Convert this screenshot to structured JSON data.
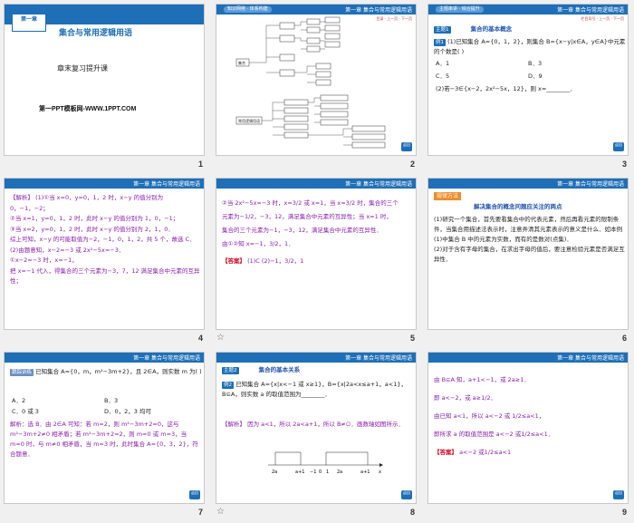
{
  "slides": [
    {
      "num": "1",
      "chapter_tag": "第一章",
      "chapter_sub": "集合与常用逻辑用语",
      "title": "集合与常用逻辑用语",
      "subtitle": "章末复习提升课",
      "site": "第一PPT模板网-WWW.1PPT.COM"
    },
    {
      "num": "2",
      "pill": "知识网络 · 体系构建",
      "header": "第一章  集合与常用逻辑用语",
      "sub_links": "目录 · 上一页 · 下一页",
      "diagram_root": "集合",
      "diagram_labels": [
        "概念",
        "关系",
        "运算",
        "元素特征",
        "表示方法",
        "子集",
        "真子集",
        "相等",
        "交集",
        "并集",
        "补集",
        "充分条件",
        "必要条件",
        "充要条件",
        "全称量词",
        "存在量词",
        "常用逻辑用语"
      ],
      "back": "返回"
    },
    {
      "num": "3",
      "pill": "主题串讲 · 综合提升",
      "header": "第一章  集合与常用逻辑用语",
      "sub_links": "栏目导引 · 上一页 · 下一页",
      "topic_tag": "主题1",
      "topic_title": "集合的基本概念",
      "ex_tag": "例1",
      "q1": "(1)已知集合 A={0，1，2}，则集合 B={x−y|x∈A，y∈A}中元素的个数是(    )",
      "choices": [
        "A．1",
        "B．3",
        "C．5",
        "D．9"
      ],
      "q2": "(2)若−3∈{x−2，2x²−5x，12}，则 x=________．",
      "back": "返回"
    },
    {
      "num": "4",
      "header": "第一章  集合与常用逻辑用语",
      "lines": [
        "【解析】 (1)①当 x=0，y=0，1，2 时，x−y 的值分别为 0，−1，−2；",
        "②当 x=1，y=0，1，2 时，此时 x−y 的值分别为 1，0，−1；",
        "③当 x=2，y=0，1，2 时，此时 x−y 的值分别为 2，1，0．",
        "综上可知，x−y 的可能取值为−2，−1，0，1，2，共 5 个，故选 C．",
        "(2)由题意知，x−2=−3 或 2x²−5x=−3．",
        "①x−2=−3 时，x=−1，",
        "把 x=−1 代入，得集合的三个元素为−3，7，12 满足集合中元素的互异性；"
      ]
    },
    {
      "num": "5",
      "header": "第一章  集合与常用逻辑用语",
      "lines": [
        "②当 2x²−5x=−3 时，x=3/2 或 x=1，当 x=3/2 时，集合的三个",
        "元素为−1/2，−3，12，满足集合中元素的互异性；当 x=1 时，",
        "集合的三个元素为−1，−3，12，满足集合中元素的互异性．",
        "由①②知 x=−1，3/2，1．"
      ],
      "answer_label": "【答案】",
      "answer": "(1)C  (2)−1，3/2，1"
    },
    {
      "num": "6",
      "header": "第一章  集合与常用逻辑用语",
      "tag": "规律方法",
      "title": "解决集合的概念问题应关注的两点",
      "lines": [
        "(1)研究一个集合，首先要看集合中的代表元素，然后再看元素的限制条件，当集合用描述法表示时，注意弄清其元素表示的意义是什么．如本例(1)中集合 B 中的元素为实数，而有的是数对(点集)．",
        "(2)对于含有字母的集合，在求出字母的值后，要注意检验元素是否满足互异性．"
      ]
    },
    {
      "num": "7",
      "header": "第一章  集合与常用逻辑用语",
      "tag": "跟踪训练",
      "q": "已知集合 A={0，m，m²−3m+2}，且 2∈A，则实数 m 为(    )",
      "choices": [
        "A．2",
        "B．3",
        "C．0 或 3",
        "D．0，2，3 均可"
      ],
      "solution": "解析：选 B．由 2∈A 可知：若 m=2，则 m²−3m+2=0，这与 m²−3m+2≠0 相矛盾；若 m²−3m+2=2，则 m=0 或 m=3，当 m=0 时，与 m≠0 相矛盾，当 m=3 时，此时集合 A={0，3，2}，符合题意．",
      "back": "返回"
    },
    {
      "num": "8",
      "header": "第一章  集合与常用逻辑用语",
      "topic_tag": "主题2",
      "topic_title": "集合的基本关系",
      "ex_tag": "例2",
      "q": "已知集合 A={x|x<−1 或 x≥1}，B={x|2a<x≤a+1，a<1}，B⊆A，则实数 a 的取值范围为________．",
      "sol_label": "【解析】",
      "sol": "因为 a<1，所以 2a<a+1，所以 B≠∅．画数轴如图所示．",
      "axis_labels": [
        "2a",
        "a+1",
        "−1",
        "0",
        "1",
        "2a",
        "a+1",
        "x"
      ],
      "back": "返回"
    },
    {
      "num": "9",
      "header": "第一章  集合与常用逻辑用语",
      "lines": [
        "由 B⊆A 知，a+1<−1，或 2a≥1．",
        "即 a<−2，或 a≥1/2．",
        "由已知 a<1，所以 a<−2 或 1/2≤a<1，",
        "即所求 a 的取值范围是 a<−2 或1/2≤a<1．"
      ],
      "answer_label": "【答案】",
      "answer": "a<−2 或1/2≤a<1",
      "back": "返回"
    }
  ],
  "colors": {
    "header_blue": "#1e6fb8",
    "accent_red": "#d0021b",
    "text_purple": "#8a1cae"
  },
  "anim_icon": "animation-star-icon"
}
